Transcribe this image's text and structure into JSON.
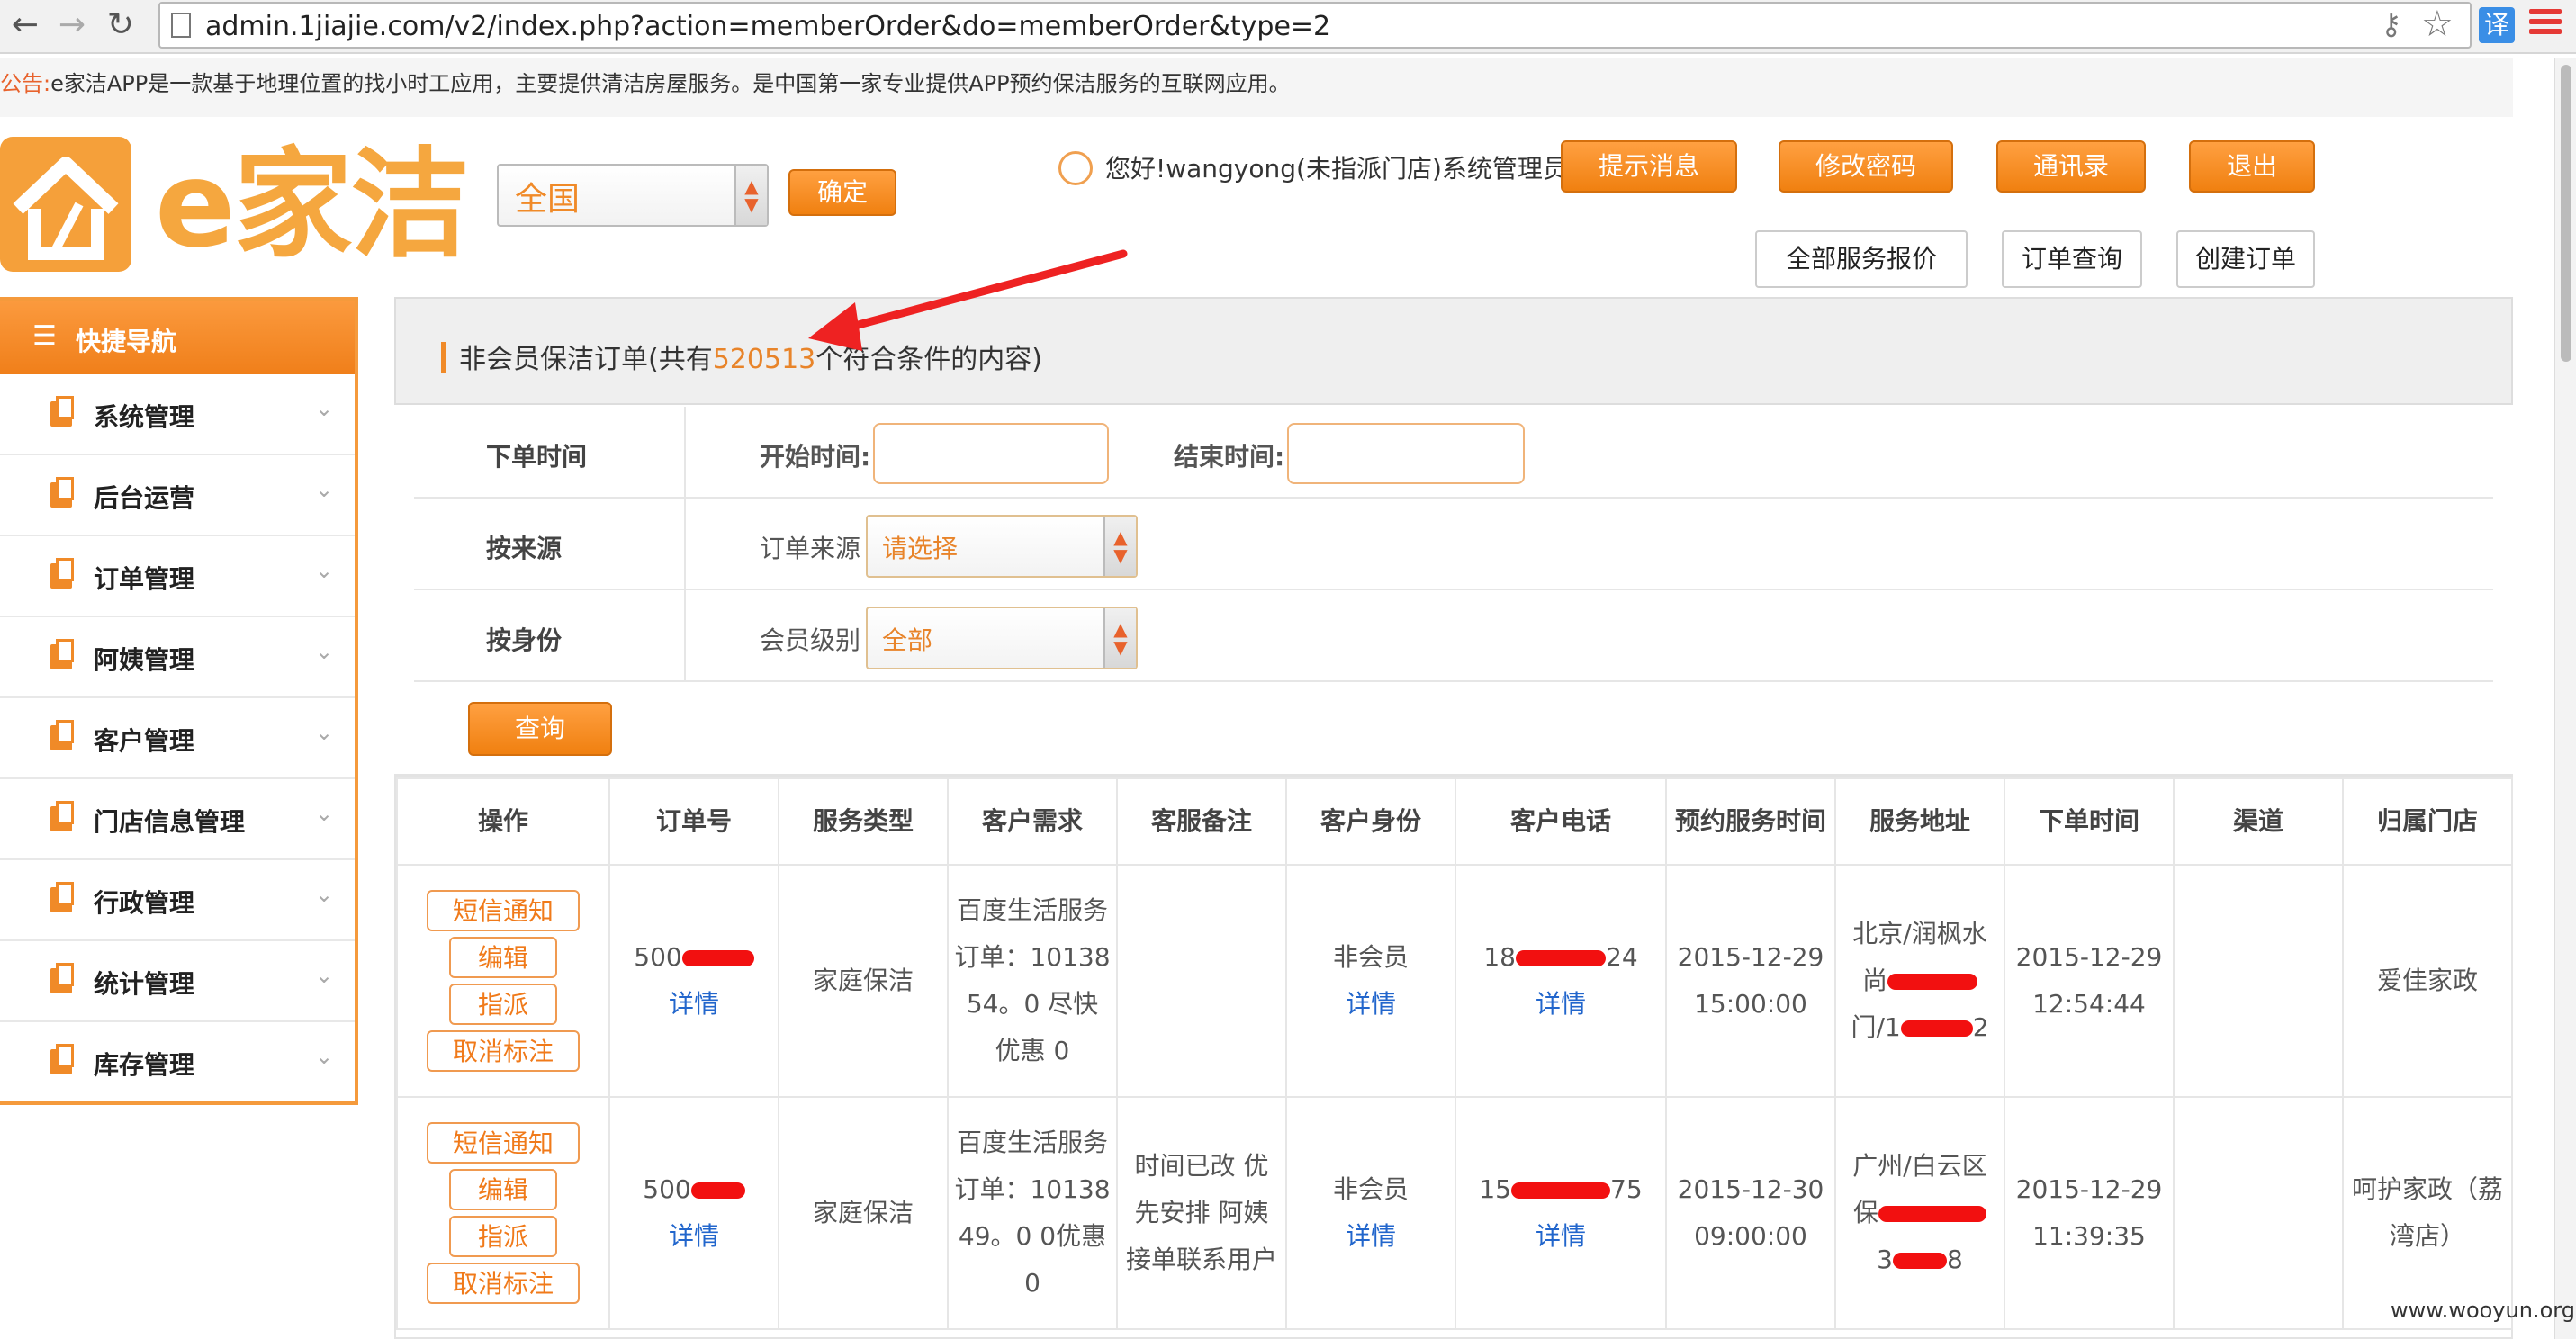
{
  "browser": {
    "url": "admin.1jiajie.com/v2/index.php?action=memberOrder&do=memberOrder&type=2",
    "translate_label": "译"
  },
  "announcement": {
    "label": "公告:",
    "text": "e家洁APP是一款基于地理位置的找小时工应用，主要提供清洁房屋服务。是中国第一家专业提供APP预约保洁服务的互联网应用。"
  },
  "header": {
    "logo_text": "e家洁",
    "region": "全国",
    "confirm_label": "确定",
    "greeting": "您好!wangyong(未指派门店)系统管理员",
    "top_buttons": [
      "提示消息",
      "修改密码",
      "通讯录",
      "退出"
    ],
    "sub_buttons": [
      "全部服务报价",
      "订单查询",
      "创建订单"
    ]
  },
  "sidebar": {
    "title": "快捷导航",
    "items": [
      "系统管理",
      "后台运营",
      "订单管理",
      "阿姨管理",
      "客户管理",
      "门店信息管理",
      "行政管理",
      "统计管理",
      "库存管理"
    ]
  },
  "panel": {
    "title_prefix": "非会员保洁订单(共有",
    "count": "520513",
    "title_suffix": "个符合条件的内容)"
  },
  "filters": {
    "order_time_label": "下单时间",
    "start_label": "开始时间:",
    "end_label": "结束时间:",
    "source_label": "按来源",
    "source_sub": "订单来源",
    "source_value": "请选择",
    "identity_label": "按身份",
    "identity_sub": "会员级别",
    "identity_value": "全部",
    "query_label": "查询"
  },
  "table": {
    "headers": [
      "操作",
      "订单号",
      "服务类型",
      "客户需求",
      "客服备注",
      "客户身份",
      "客户电话",
      "预约服务时间",
      "服务地址",
      "下单时间",
      "渠道",
      "归属门店"
    ],
    "action_labels": [
      "短信通知",
      "编辑",
      "指派",
      "取消标注"
    ],
    "detail_label": "详情",
    "rows": [
      {
        "order_prefix": "500",
        "service_type": "家庭保洁",
        "demand": "百度生活服务订单：1013854。0 尽快优惠 0",
        "note": "",
        "identity": "非会员",
        "phone_prefix": "18",
        "phone_suffix": "24",
        "appoint_date": "2015-12-29",
        "appoint_time": "15:00:00",
        "address_line1": "北京/润枫水",
        "address_line2": "尚",
        "address_line3": "门/1",
        "address_line3_suffix": "2",
        "order_date": "2015-12-29",
        "order_time": "12:54:44",
        "channel": "",
        "store": "爱佳家政"
      },
      {
        "order_prefix": "500",
        "service_type": "家庭保洁",
        "demand": "百度生活服务订单：1013849。0 0优惠 0",
        "note": "时间已改 优先安排 阿姨接单联系用户",
        "identity": "非会员",
        "phone_prefix": "15",
        "phone_suffix": "75",
        "appoint_date": "2015-12-30",
        "appoint_time": "09:00:00",
        "address_line1": "广州/白云区",
        "address_line2": "保",
        "address_line3": "3",
        "address_line3_suffix": "8",
        "order_date": "2015-12-29",
        "order_time": "11:39:35",
        "channel": "",
        "store": "呵护家政（荔湾店）"
      }
    ]
  },
  "watermark": "www.wooyun.org"
}
